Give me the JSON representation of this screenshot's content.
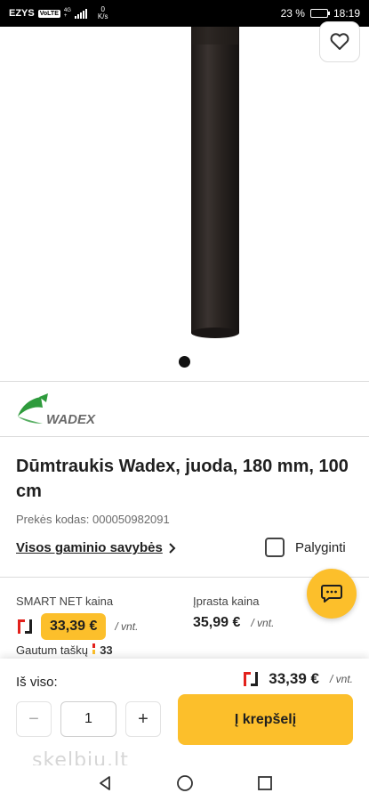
{
  "status_bar": {
    "carrier": "EZYS",
    "volte": "VoLTE",
    "network_top": "4G",
    "network_bottom": "+",
    "speed_value": "0",
    "speed_unit": "K/s",
    "battery": "23 %",
    "battery_level": 0.23,
    "time": "18:19"
  },
  "product": {
    "image_dots": 1,
    "brand_name": "WADEX",
    "title": "Dūmtraukis Wadex, juoda, 180 mm, 100 cm",
    "code": "Prekės kodas: 000050982091",
    "features_link": "Visos gaminio savybės",
    "compare_label": "Palyginti"
  },
  "pricing": {
    "smart_label": "SMART NET kaina",
    "smart_price": "33,39 €",
    "smart_unit": "/ vnt.",
    "points_label": "Gautum taškų",
    "points_value": "33",
    "regular_label": "Įprasta kaina",
    "regular_price": "35,99 €",
    "regular_unit": "/ vnt."
  },
  "cart": {
    "total_label": "Iš viso:",
    "total_price": "33,39 €",
    "total_unit": "/ vnt.",
    "quantity": "1",
    "minus": "−",
    "plus": "+",
    "add_button": "Į krepšelį"
  },
  "watermark": "skelbiu.lt",
  "colors": {
    "accent": "#fcbf2b",
    "brand_green": "#2e9b3c",
    "brand_gray": "#6a6a6a",
    "logo_red": "#e2211c"
  }
}
